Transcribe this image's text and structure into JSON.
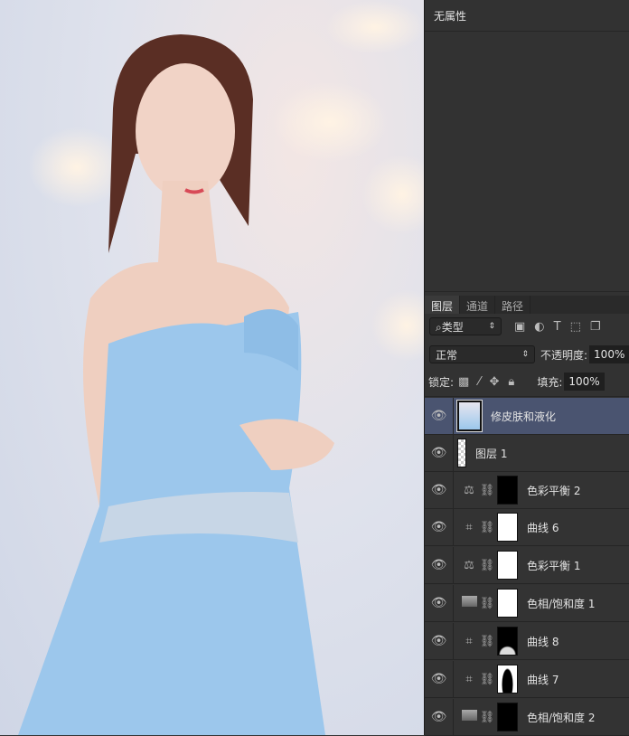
{
  "properties": {
    "title": "无属性"
  },
  "tabs": [
    {
      "label": "图层"
    },
    {
      "label": "通道"
    },
    {
      "label": "路径"
    }
  ],
  "filter": {
    "label": "类型"
  },
  "blend": {
    "mode": "正常",
    "opacity_label": "不透明度:",
    "opacity": "100%"
  },
  "lock": {
    "label": "锁定:",
    "fill_label": "填充:",
    "fill": "100%"
  },
  "layers": [
    {
      "name": "修皮肤和液化",
      "type": "pixel",
      "selected": true
    },
    {
      "name": "图层 1",
      "type": "empty"
    },
    {
      "name": "色彩平衡 2",
      "type": "color-balance",
      "mask": "black"
    },
    {
      "name": "曲线 6",
      "type": "curves",
      "mask": "white"
    },
    {
      "name": "色彩平衡 1",
      "type": "color-balance",
      "mask": "white"
    },
    {
      "name": "色相/饱和度 1",
      "type": "hue-saturation",
      "mask": "white"
    },
    {
      "name": "曲线 8",
      "type": "curves",
      "mask": "black"
    },
    {
      "name": "曲线 7",
      "type": "curves",
      "mask": "white-silhouette"
    },
    {
      "name": "色相/饱和度 2",
      "type": "hue-saturation",
      "mask": "black"
    }
  ]
}
